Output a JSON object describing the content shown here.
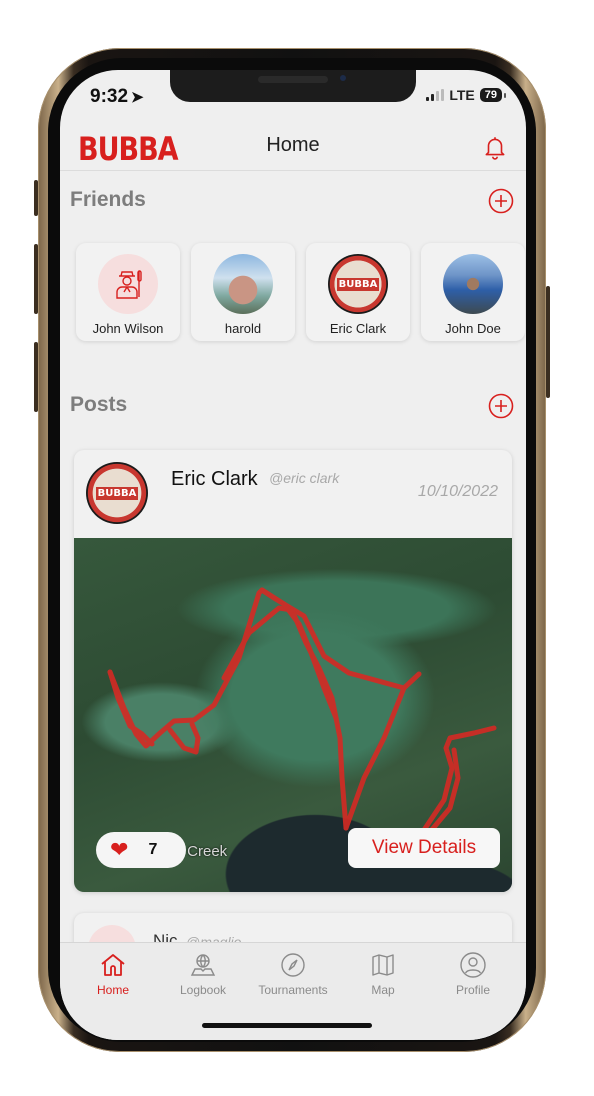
{
  "status_bar": {
    "time": "9:32",
    "network": "LTE",
    "battery": "79"
  },
  "header": {
    "logo": "BUBBA",
    "title": "Home"
  },
  "friends": {
    "title": "Friends",
    "items": [
      {
        "name": "John Wilson",
        "avatar": "angler-placeholder-icon"
      },
      {
        "name": "harold",
        "avatar": "photo"
      },
      {
        "name": "Eric Clark",
        "avatar": "bubba-badge"
      },
      {
        "name": "John Doe",
        "avatar": "photo"
      }
    ]
  },
  "posts": {
    "title": "Posts",
    "items": [
      {
        "author": "Eric Clark",
        "handle": "@eric clark",
        "date": "10/10/2022",
        "map_label": "ck Creek",
        "likes": "7",
        "view_details_label": "View Details",
        "avatar_badge": "BUBBA"
      },
      {
        "author": "Nic",
        "handle": "@maglio"
      }
    ]
  },
  "tab_bar": {
    "items": [
      {
        "label": "Home",
        "icon": "home-icon",
        "active": true
      },
      {
        "label": "Logbook",
        "icon": "logbook-icon",
        "active": false
      },
      {
        "label": "Tournaments",
        "icon": "compass-icon",
        "active": false
      },
      {
        "label": "Map",
        "icon": "map-icon",
        "active": false
      },
      {
        "label": "Profile",
        "icon": "profile-icon",
        "active": false
      }
    ]
  },
  "colors": {
    "accent": "#d8201e",
    "background": "#efefef",
    "muted": "#8b8b8b"
  }
}
